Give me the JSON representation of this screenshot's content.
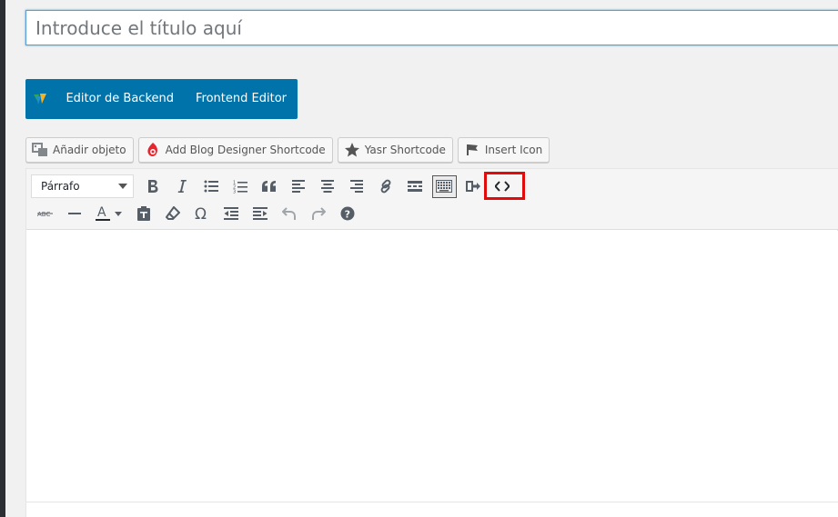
{
  "title": {
    "placeholder": "Introduce el título aquí"
  },
  "composer": {
    "backend_label": "Editor de Backend",
    "frontend_label": "Frontend Editor",
    "accent": "#0073aa"
  },
  "media_buttons": [
    {
      "label": "Añadir objeto",
      "icon": "media-icon"
    },
    {
      "label": "Add Blog Designer Shortcode",
      "icon": "blog-designer-icon"
    },
    {
      "label": "Yasr Shortcode",
      "icon": "star-icon"
    },
    {
      "label": "Insert Icon",
      "icon": "flag-icon"
    }
  ],
  "toolbar": {
    "format_select": "Párrafo",
    "row1": [
      "bold-icon",
      "italic-icon",
      "bullet-list-icon",
      "numbered-list-icon",
      "blockquote-icon",
      "align-left-icon",
      "align-center-icon",
      "align-right-icon",
      "link-icon",
      "read-more-icon",
      "toolbar-toggle-icon",
      "fullscreen-exit-icon",
      "code-icon"
    ],
    "row2": [
      "strikethrough-icon",
      "horizontal-line-icon",
      "text-color-icon",
      "paste-text-icon",
      "clear-format-icon",
      "special-char-icon",
      "outdent-icon",
      "indent-icon",
      "undo-icon",
      "redo-icon",
      "help-icon"
    ],
    "highlight_color": "#e10b0b"
  }
}
